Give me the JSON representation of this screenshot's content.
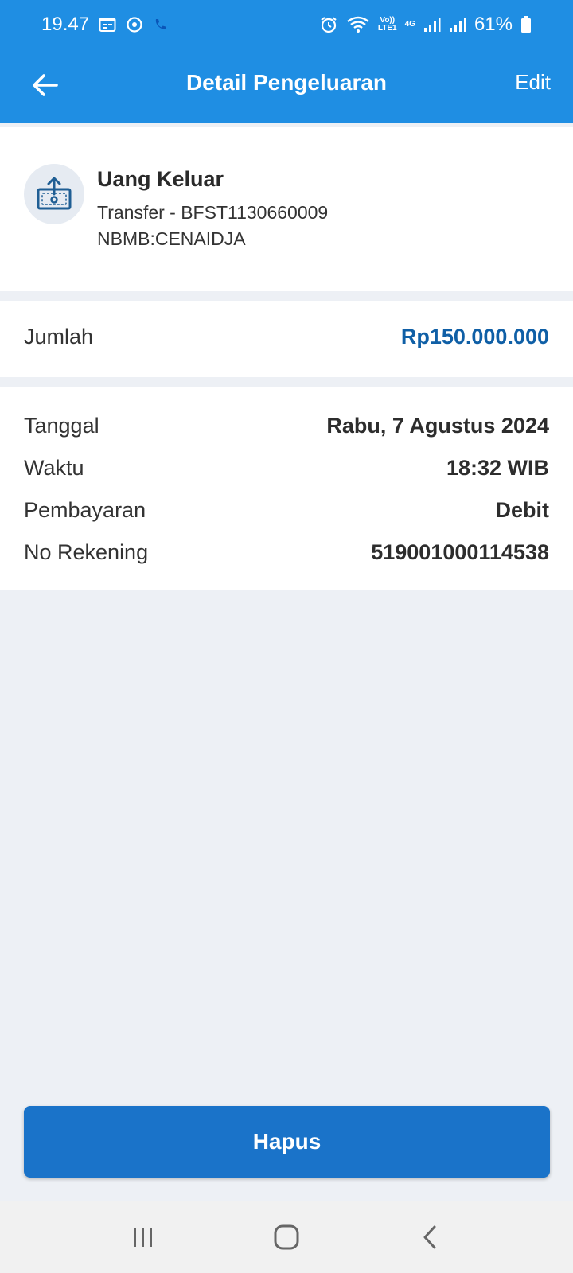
{
  "status_bar": {
    "time": "19.47",
    "battery": "61%",
    "network": "4G",
    "volte_line1": "Vo))",
    "volte_line2": "LTE1"
  },
  "header": {
    "title": "Detail Pengeluaran",
    "edit_label": "Edit"
  },
  "transaction": {
    "type": "Uang Keluar",
    "description_line1": "Transfer - BFST1130660009",
    "description_line2": "NBMB:CENAIDJA",
    "icon": "money-out-icon"
  },
  "amount": {
    "label": "Jumlah",
    "value": "Rp150.000.000"
  },
  "details": [
    {
      "label": "Tanggal",
      "value": "Rabu, 7 Agustus 2024"
    },
    {
      "label": "Waktu",
      "value": "18:32 WIB"
    },
    {
      "label": "Pembayaran",
      "value": "Debit"
    },
    {
      "label": "No Rekening",
      "value": "519001000114538"
    }
  ],
  "actions": {
    "delete_label": "Hapus"
  },
  "colors": {
    "primary": "#1f8ee3",
    "button": "#1a73c9",
    "amount": "#0f5fa6",
    "background": "#edf0f5"
  }
}
